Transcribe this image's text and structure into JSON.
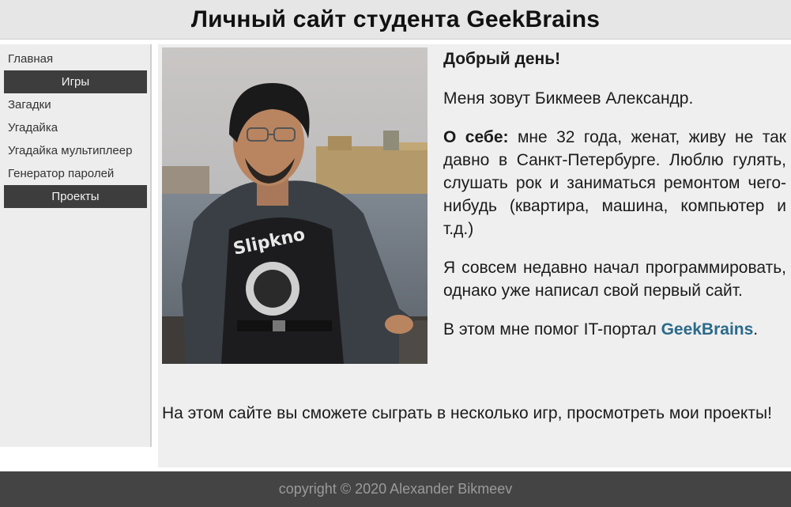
{
  "header": {
    "title": "Личный сайт студента GeekBrains"
  },
  "sidebar": {
    "items": [
      {
        "label": "Главная"
      },
      {
        "label": "Игры"
      },
      {
        "label": "Загадки"
      },
      {
        "label": "Угадайка"
      },
      {
        "label": "Угадайка мультиплеер"
      },
      {
        "label": "Генератор паролей"
      },
      {
        "label": "Проекты"
      }
    ]
  },
  "main": {
    "greeting": "Добрый день!",
    "intro": "Меня зовут Бикмеев Александр.",
    "about_label": "О себе:",
    "about_text": " мне 32 года, женат, живу не так давно в Санкт-Петербурге. Люблю гулять, слушать рок и заниматься ремонтом чего-нибудь (квартира, машина, компьютер и т.д.)",
    "programming": "Я совсем недавно начал программировать, однако уже написал свой первый сайт.",
    "help_text": "В этом мне помог IT-портал ",
    "help_link": "GeekBrains",
    "help_end": ".",
    "bottom": "На этом сайте вы сможете сыграть в несколько игр, просмотреть мои проекты!",
    "photo": {
      "shirt_text": "Slipkno"
    }
  },
  "footer": {
    "copyright": "copyright © 2020 Alexander Bikmeev"
  },
  "colors": {
    "accent_link": "#2b6a8a",
    "nav_dark": "#3d3d3d",
    "footer_bg": "#444444"
  }
}
